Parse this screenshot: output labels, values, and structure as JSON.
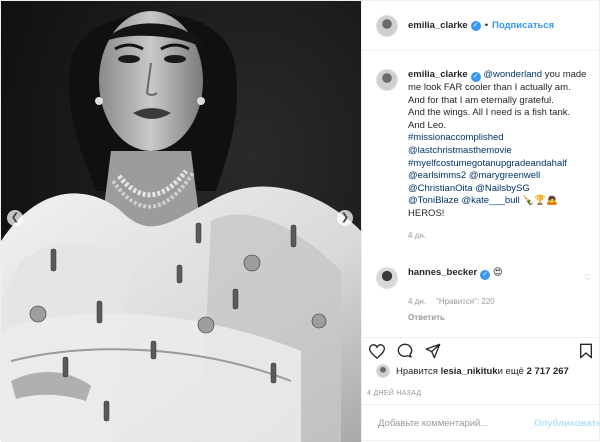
{
  "header": {
    "username": "emilia_clarke",
    "separator": "•",
    "follow_label": "Подписаться"
  },
  "caption": {
    "username": "emilia_clarke",
    "mention": "@wonderland",
    "text_1": " you made me look FAR cooler than I actually am.",
    "text_2": "And for that I am eternally grateful.",
    "text_3": "And the wings. All I need is a fish tank.",
    "text_4": "And Leo.",
    "hashtag_1": "#missionaccomplished",
    "mention_2": "@lastchristmasthemovie",
    "hashtag_2": "#myelfcostumegotanupgradeandahalf",
    "mention_3a": "@earlsimms2",
    "mention_3b": "@marygreenwell",
    "mention_4a": "@ChristianOita",
    "mention_4b": "@NailsbySG",
    "mention_5a": "@ToniBlaze",
    "mention_5b": "@kate___bull",
    "emoji_tail": " 🍾🏆🙇",
    "text_6": "HEROS!",
    "time": "4 дн."
  },
  "reply": {
    "username": "hannes_becker",
    "text": "😍",
    "time": "4 дн.",
    "likes": "\"Нравится\": 220",
    "answer_label": "Ответить"
  },
  "likes": {
    "prefix": "Нравится ",
    "user": "lesia_nikituk",
    "middle": " и ещё ",
    "count": "2 717 267"
  },
  "date": "4 ДНЕЙ НАЗАД",
  "comment_box": {
    "placeholder": "Добавьте комментарий...",
    "publish_label": "Опубликовать"
  },
  "icons": {
    "like": "heart-icon",
    "comment": "comment-icon",
    "share": "share-icon",
    "save": "bookmark-icon",
    "prev": "chevron-left-icon",
    "next": "chevron-right-icon"
  },
  "colors": {
    "link": "#003569",
    "accent": "#3897f0",
    "muted": "#999999",
    "publish_disabled": "#b2dffc",
    "border": "#efefef"
  }
}
